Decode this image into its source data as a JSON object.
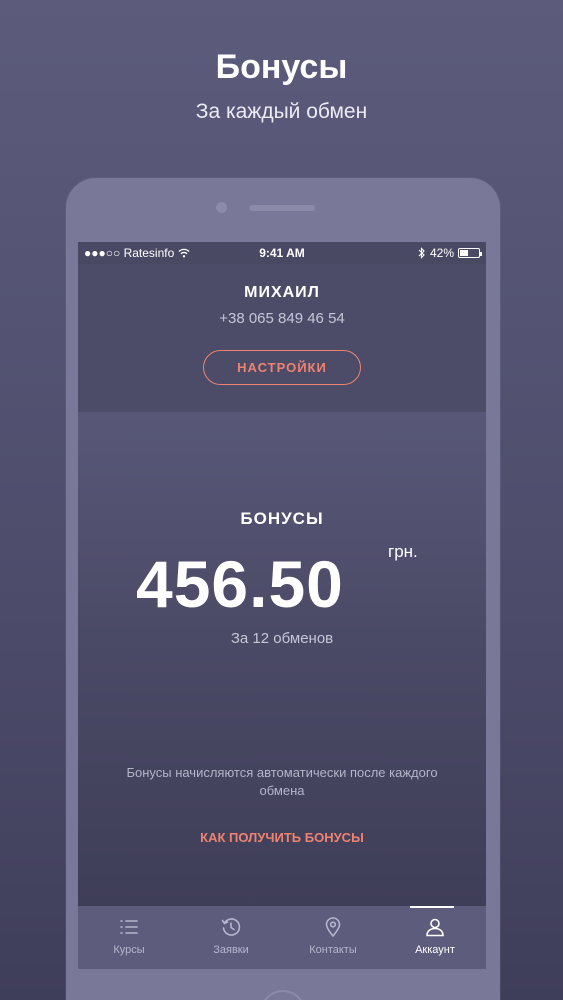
{
  "promo": {
    "title": "Бонусы",
    "subtitle": "За каждый обмен"
  },
  "status_bar": {
    "carrier": "●●●○○ Ratesinfo",
    "time": "9:41 AM",
    "battery": "42%",
    "battery_level": 0.42
  },
  "profile": {
    "name": "МИХАИЛ",
    "phone": "+38 065 849 46 54",
    "settings_label": "НАСТРОЙКИ"
  },
  "bonus": {
    "label": "БОНУСЫ",
    "amount": "456.50",
    "currency": "грн.",
    "exchanges": "За 12 обменов",
    "note": "Бонусы начисляются автоматически после каждого обмена",
    "how_to_label": "КАК ПОЛУЧИТЬ БОНУСЫ"
  },
  "tabs": [
    {
      "label": "Курсы",
      "icon": "list-icon",
      "active": false
    },
    {
      "label": "Заявки",
      "icon": "history-icon",
      "active": false
    },
    {
      "label": "Контакты",
      "icon": "location-pin-icon",
      "active": false
    },
    {
      "label": "Аккаунт",
      "icon": "user-icon",
      "active": true
    }
  ],
  "colors": {
    "accent": "#ef8270",
    "background": "#4a4964",
    "tab_bar": "#5d5c7d"
  }
}
